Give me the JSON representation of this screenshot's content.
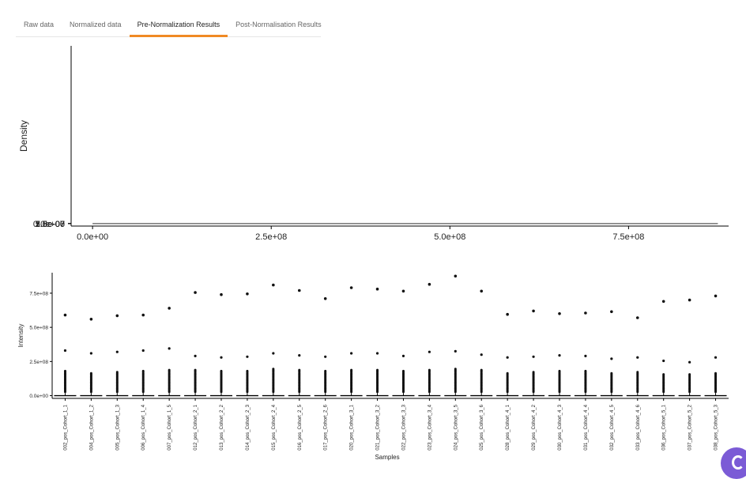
{
  "tabs": [
    {
      "label": "Raw data",
      "active": false
    },
    {
      "label": "Normalized data",
      "active": false
    },
    {
      "label": "Pre-Normalization Results",
      "active": true
    },
    {
      "label": "Post-Normalisation Results",
      "active": false
    }
  ],
  "accent_color": "#f08a24",
  "chart_data": [
    {
      "type": "line",
      "title": "",
      "xlabel": "",
      "ylabel": "Density",
      "xlim": [
        -30000000,
        890000000
      ],
      "ylim": [
        -15000000000,
        1080000000000
      ],
      "y_scale_factor": 1e-18,
      "x_tick_values": [
        0,
        250000000,
        500000000,
        750000000
      ],
      "x_tick_labels": [
        "0.0e+00",
        "2.5e+08",
        "5.0e+08",
        "7.5e+08"
      ],
      "y_tick_values": [
        0,
        250,
        500,
        750,
        1000
      ],
      "y_tick_labels": [
        "0.0e+00",
        "2.5e-07",
        "5.0e-07",
        "7.5e-07",
        "1.0e-06"
      ],
      "series": [
        {
          "x": [
            0,
            800000,
            1200000,
            1600000,
            2200000,
            3000000,
            4000000,
            5500000,
            7000000,
            9000000,
            12000000,
            16000000,
            22000000,
            30000000,
            45000000,
            70000000,
            120000000,
            200000000,
            350000000,
            500000000,
            650000000,
            875000000
          ],
          "y": [
            1050,
            1040,
            950,
            620,
            300,
            150,
            85,
            55,
            40,
            30,
            22,
            17,
            13,
            10,
            7,
            5,
            4,
            3,
            2,
            1.5,
            1,
            0.5
          ]
        }
      ],
      "grid": false
    },
    {
      "type": "box",
      "title": "",
      "xlabel": "Samples",
      "ylabel": "Intensity",
      "ylim": [
        -20000000,
        900000000
      ],
      "y_tick_values": [
        0,
        250000000,
        500000000,
        750000000
      ],
      "y_tick_labels": [
        "0.0e+00",
        "2.5e+08",
        "5.0e+08",
        "7.5e+08"
      ],
      "categories": [
        "002_pos_Cohort_1_1",
        "004_pos_Cohort_1_2",
        "005_pos_Cohort_1_3",
        "006_pos_Cohort_1_4",
        "007_pos_Cohort_1_5",
        "012_pos_Cohort_2_1",
        "013_pos_Cohort_2_2",
        "014_pos_Cohort_2_3",
        "015_pos_Cohort_2_4",
        "016_pos_Cohort_2_5",
        "017_pos_Cohort_2_6",
        "020_pos_Cohort_3_1",
        "021_pos_Cohort_3_2",
        "022_pos_Cohort_3_3",
        "023_pos_Cohort_3_4",
        "024_pos_Cohort_3_5",
        "025_pos_Cohort_3_6",
        "028_pos_Cohort_4_1",
        "029_pos_Cohort_4_2",
        "030_pos_Cohort_4_3",
        "031_pos_Cohort_4_4",
        "032_pos_Cohort_4_5",
        "033_pos_Cohort_4_6",
        "036_pos_Cohort_5_1",
        "037_pos_Cohort_5_2",
        "038_pos_Cohort_5_3"
      ],
      "max_outlier": [
        590000000,
        560000000,
        585000000,
        590000000,
        640000000,
        755000000,
        740000000,
        745000000,
        810000000,
        770000000,
        710000000,
        790000000,
        780000000,
        765000000,
        815000000,
        875000000,
        765000000,
        595000000,
        620000000,
        600000000,
        605000000,
        615000000,
        570000000,
        690000000,
        700000000,
        730000000
      ],
      "second_outlier": [
        330000000,
        310000000,
        320000000,
        330000000,
        345000000,
        290000000,
        280000000,
        285000000,
        310000000,
        295000000,
        285000000,
        310000000,
        310000000,
        290000000,
        320000000,
        325000000,
        300000000,
        280000000,
        285000000,
        295000000,
        290000000,
        270000000,
        280000000,
        255000000,
        245000000,
        280000000
      ],
      "outlier_fill_top": [
        180000000,
        170000000,
        175000000,
        185000000,
        195000000,
        190000000,
        185000000,
        185000000,
        200000000,
        195000000,
        180000000,
        190000000,
        190000000,
        185000000,
        195000000,
        200000000,
        190000000,
        170000000,
        175000000,
        180000000,
        180000000,
        170000000,
        175000000,
        160000000,
        160000000,
        170000000
      ],
      "median": [
        0,
        0,
        0,
        0,
        0,
        0,
        0,
        0,
        0,
        0,
        0,
        0,
        0,
        0,
        0,
        0,
        0,
        0,
        0,
        0,
        0,
        0,
        0,
        0,
        0,
        0
      ],
      "whisker_high": [
        20000000,
        20000000,
        20000000,
        20000000,
        20000000,
        20000000,
        20000000,
        20000000,
        20000000,
        20000000,
        20000000,
        20000000,
        20000000,
        20000000,
        20000000,
        20000000,
        20000000,
        20000000,
        20000000,
        20000000,
        20000000,
        20000000,
        20000000,
        20000000,
        20000000,
        20000000
      ],
      "grid": false
    }
  ]
}
